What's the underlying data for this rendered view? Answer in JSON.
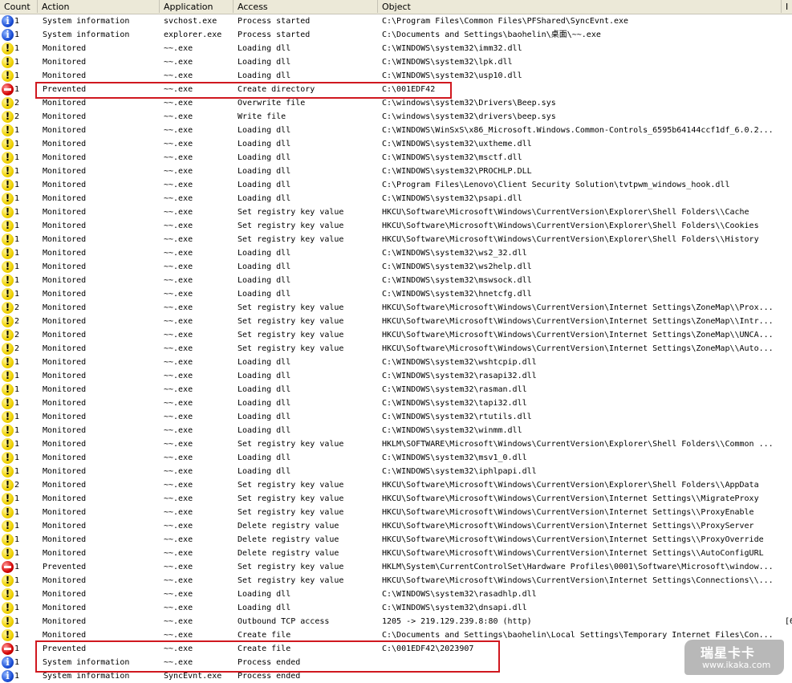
{
  "columns": [
    "Count",
    "Action",
    "Application",
    "Access",
    "Object",
    "I"
  ],
  "rows": [
    {
      "icon": "info",
      "count": "1",
      "action": "System information",
      "app": "svchost.exe",
      "access": "Process started",
      "object": "C:\\Program Files\\Common Files\\PFShared\\SyncEvnt.exe",
      "extra": ""
    },
    {
      "icon": "info",
      "count": "1",
      "action": "System information",
      "app": "explorer.exe",
      "access": "Process started",
      "object": "C:\\Documents and Settings\\baohelin\\桌面\\~~.exe",
      "extra": ""
    },
    {
      "icon": "warn",
      "count": "1",
      "action": "Monitored",
      "app": "~~.exe",
      "access": "Loading dll",
      "object": "C:\\WINDOWS\\system32\\imm32.dll",
      "extra": ""
    },
    {
      "icon": "warn",
      "count": "1",
      "action": "Monitored",
      "app": "~~.exe",
      "access": "Loading dll",
      "object": "C:\\WINDOWS\\system32\\lpk.dll",
      "extra": ""
    },
    {
      "icon": "warn",
      "count": "1",
      "action": "Monitored",
      "app": "~~.exe",
      "access": "Loading dll",
      "object": "C:\\WINDOWS\\system32\\usp10.dll",
      "extra": ""
    },
    {
      "icon": "stop",
      "count": "1",
      "action": "Prevented",
      "app": "~~.exe",
      "access": "Create directory",
      "object": "C:\\001EDF42",
      "extra": ""
    },
    {
      "icon": "warn",
      "count": "2",
      "action": "Monitored",
      "app": "~~.exe",
      "access": "Overwrite file",
      "object": "C:\\windows\\system32\\Drivers\\Beep.sys",
      "extra": ""
    },
    {
      "icon": "warn",
      "count": "2",
      "action": "Monitored",
      "app": "~~.exe",
      "access": "Write file",
      "object": "C:\\windows\\system32\\drivers\\beep.sys",
      "extra": ""
    },
    {
      "icon": "warn",
      "count": "1",
      "action": "Monitored",
      "app": "~~.exe",
      "access": "Loading dll",
      "object": "C:\\WINDOWS\\WinSxS\\x86_Microsoft.Windows.Common-Controls_6595b64144ccf1df_6.0.2...",
      "extra": ""
    },
    {
      "icon": "warn",
      "count": "1",
      "action": "Monitored",
      "app": "~~.exe",
      "access": "Loading dll",
      "object": "C:\\WINDOWS\\system32\\uxtheme.dll",
      "extra": ""
    },
    {
      "icon": "warn",
      "count": "1",
      "action": "Monitored",
      "app": "~~.exe",
      "access": "Loading dll",
      "object": "C:\\WINDOWS\\system32\\msctf.dll",
      "extra": ""
    },
    {
      "icon": "warn",
      "count": "1",
      "action": "Monitored",
      "app": "~~.exe",
      "access": "Loading dll",
      "object": "C:\\WINDOWS\\system32\\PROCHLP.DLL",
      "extra": ""
    },
    {
      "icon": "warn",
      "count": "1",
      "action": "Monitored",
      "app": "~~.exe",
      "access": "Loading dll",
      "object": "C:\\Program Files\\Lenovo\\Client Security Solution\\tvtpwm_windows_hook.dll",
      "extra": ""
    },
    {
      "icon": "warn",
      "count": "1",
      "action": "Monitored",
      "app": "~~.exe",
      "access": "Loading dll",
      "object": "C:\\WINDOWS\\system32\\psapi.dll",
      "extra": ""
    },
    {
      "icon": "warn",
      "count": "1",
      "action": "Monitored",
      "app": "~~.exe",
      "access": "Set registry key value",
      "object": "HKCU\\Software\\Microsoft\\Windows\\CurrentVersion\\Explorer\\Shell Folders\\\\Cache",
      "extra": ""
    },
    {
      "icon": "warn",
      "count": "1",
      "action": "Monitored",
      "app": "~~.exe",
      "access": "Set registry key value",
      "object": "HKCU\\Software\\Microsoft\\Windows\\CurrentVersion\\Explorer\\Shell Folders\\\\Cookies",
      "extra": ""
    },
    {
      "icon": "warn",
      "count": "1",
      "action": "Monitored",
      "app": "~~.exe",
      "access": "Set registry key value",
      "object": "HKCU\\Software\\Microsoft\\Windows\\CurrentVersion\\Explorer\\Shell Folders\\\\History",
      "extra": ""
    },
    {
      "icon": "warn",
      "count": "1",
      "action": "Monitored",
      "app": "~~.exe",
      "access": "Loading dll",
      "object": "C:\\WINDOWS\\system32\\ws2_32.dll",
      "extra": ""
    },
    {
      "icon": "warn",
      "count": "1",
      "action": "Monitored",
      "app": "~~.exe",
      "access": "Loading dll",
      "object": "C:\\WINDOWS\\system32\\ws2help.dll",
      "extra": ""
    },
    {
      "icon": "warn",
      "count": "1",
      "action": "Monitored",
      "app": "~~.exe",
      "access": "Loading dll",
      "object": "C:\\WINDOWS\\system32\\mswsock.dll",
      "extra": ""
    },
    {
      "icon": "warn",
      "count": "1",
      "action": "Monitored",
      "app": "~~.exe",
      "access": "Loading dll",
      "object": "C:\\WINDOWS\\system32\\hnetcfg.dll",
      "extra": ""
    },
    {
      "icon": "warn",
      "count": "2",
      "action": "Monitored",
      "app": "~~.exe",
      "access": "Set registry key value",
      "object": "HKCU\\Software\\Microsoft\\Windows\\CurrentVersion\\Internet Settings\\ZoneMap\\\\Prox...",
      "extra": ""
    },
    {
      "icon": "warn",
      "count": "2",
      "action": "Monitored",
      "app": "~~.exe",
      "access": "Set registry key value",
      "object": "HKCU\\Software\\Microsoft\\Windows\\CurrentVersion\\Internet Settings\\ZoneMap\\\\Intr...",
      "extra": ""
    },
    {
      "icon": "warn",
      "count": "2",
      "action": "Monitored",
      "app": "~~.exe",
      "access": "Set registry key value",
      "object": "HKCU\\Software\\Microsoft\\Windows\\CurrentVersion\\Internet Settings\\ZoneMap\\\\UNCA...",
      "extra": ""
    },
    {
      "icon": "warn",
      "count": "2",
      "action": "Monitored",
      "app": "~~.exe",
      "access": "Set registry key value",
      "object": "HKCU\\Software\\Microsoft\\Windows\\CurrentVersion\\Internet Settings\\ZoneMap\\\\Auto...",
      "extra": ""
    },
    {
      "icon": "warn",
      "count": "1",
      "action": "Monitored",
      "app": "~~.exe",
      "access": "Loading dll",
      "object": "C:\\WINDOWS\\system32\\wshtcpip.dll",
      "extra": ""
    },
    {
      "icon": "warn",
      "count": "1",
      "action": "Monitored",
      "app": "~~.exe",
      "access": "Loading dll",
      "object": "C:\\WINDOWS\\system32\\rasapi32.dll",
      "extra": ""
    },
    {
      "icon": "warn",
      "count": "1",
      "action": "Monitored",
      "app": "~~.exe",
      "access": "Loading dll",
      "object": "C:\\WINDOWS\\system32\\rasman.dll",
      "extra": ""
    },
    {
      "icon": "warn",
      "count": "1",
      "action": "Monitored",
      "app": "~~.exe",
      "access": "Loading dll",
      "object": "C:\\WINDOWS\\system32\\tapi32.dll",
      "extra": ""
    },
    {
      "icon": "warn",
      "count": "1",
      "action": "Monitored",
      "app": "~~.exe",
      "access": "Loading dll",
      "object": "C:\\WINDOWS\\system32\\rtutils.dll",
      "extra": ""
    },
    {
      "icon": "warn",
      "count": "1",
      "action": "Monitored",
      "app": "~~.exe",
      "access": "Loading dll",
      "object": "C:\\WINDOWS\\system32\\winmm.dll",
      "extra": ""
    },
    {
      "icon": "warn",
      "count": "1",
      "action": "Monitored",
      "app": "~~.exe",
      "access": "Set registry key value",
      "object": "HKLM\\SOFTWARE\\Microsoft\\Windows\\CurrentVersion\\Explorer\\Shell Folders\\\\Common ...",
      "extra": ""
    },
    {
      "icon": "warn",
      "count": "1",
      "action": "Monitored",
      "app": "~~.exe",
      "access": "Loading dll",
      "object": "C:\\WINDOWS\\system32\\msv1_0.dll",
      "extra": ""
    },
    {
      "icon": "warn",
      "count": "1",
      "action": "Monitored",
      "app": "~~.exe",
      "access": "Loading dll",
      "object": "C:\\WINDOWS\\system32\\iphlpapi.dll",
      "extra": ""
    },
    {
      "icon": "warn",
      "count": "2",
      "action": "Monitored",
      "app": "~~.exe",
      "access": "Set registry key value",
      "object": "HKCU\\Software\\Microsoft\\Windows\\CurrentVersion\\Explorer\\Shell Folders\\\\AppData",
      "extra": ""
    },
    {
      "icon": "warn",
      "count": "1",
      "action": "Monitored",
      "app": "~~.exe",
      "access": "Set registry key value",
      "object": "HKCU\\Software\\Microsoft\\Windows\\CurrentVersion\\Internet Settings\\\\MigrateProxy",
      "extra": ""
    },
    {
      "icon": "warn",
      "count": "1",
      "action": "Monitored",
      "app": "~~.exe",
      "access": "Set registry key value",
      "object": "HKCU\\Software\\Microsoft\\Windows\\CurrentVersion\\Internet Settings\\\\ProxyEnable",
      "extra": ""
    },
    {
      "icon": "warn",
      "count": "1",
      "action": "Monitored",
      "app": "~~.exe",
      "access": "Delete registry value",
      "object": "HKCU\\Software\\Microsoft\\Windows\\CurrentVersion\\Internet Settings\\\\ProxyServer",
      "extra": ""
    },
    {
      "icon": "warn",
      "count": "1",
      "action": "Monitored",
      "app": "~~.exe",
      "access": "Delete registry value",
      "object": "HKCU\\Software\\Microsoft\\Windows\\CurrentVersion\\Internet Settings\\\\ProxyOverride",
      "extra": ""
    },
    {
      "icon": "warn",
      "count": "1",
      "action": "Monitored",
      "app": "~~.exe",
      "access": "Delete registry value",
      "object": "HKCU\\Software\\Microsoft\\Windows\\CurrentVersion\\Internet Settings\\\\AutoConfigURL",
      "extra": ""
    },
    {
      "icon": "stop",
      "count": "1",
      "action": "Prevented",
      "app": "~~.exe",
      "access": "Set registry key value",
      "object": "HKLM\\System\\CurrentControlSet\\Hardware Profiles\\0001\\Software\\Microsoft\\window...",
      "extra": ""
    },
    {
      "icon": "warn",
      "count": "1",
      "action": "Monitored",
      "app": "~~.exe",
      "access": "Set registry key value",
      "object": "HKCU\\Software\\Microsoft\\Windows\\CurrentVersion\\Internet Settings\\Connections\\\\...",
      "extra": ""
    },
    {
      "icon": "warn",
      "count": "1",
      "action": "Monitored",
      "app": "~~.exe",
      "access": "Loading dll",
      "object": "C:\\WINDOWS\\system32\\rasadhlp.dll",
      "extra": ""
    },
    {
      "icon": "warn",
      "count": "1",
      "action": "Monitored",
      "app": "~~.exe",
      "access": "Loading dll",
      "object": "C:\\WINDOWS\\system32\\dnsapi.dll",
      "extra": ""
    },
    {
      "icon": "warn",
      "count": "1",
      "action": "Monitored",
      "app": "~~.exe",
      "access": "Outbound TCP access",
      "object": "1205 -> 219.129.239.8:80 (http)",
      "extra": "[6"
    },
    {
      "icon": "warn",
      "count": "1",
      "action": "Monitored",
      "app": "~~.exe",
      "access": "Create file",
      "object": "C:\\Documents and Settings\\baohelin\\Local Settings\\Temporary Internet Files\\Con...",
      "extra": ""
    },
    {
      "icon": "stop",
      "count": "1",
      "action": "Prevented",
      "app": "~~.exe",
      "access": "Create file",
      "object": "C:\\001EDF42\\2023907",
      "extra": ""
    },
    {
      "icon": "info",
      "count": "1",
      "action": "System information",
      "app": "~~.exe",
      "access": "Process ended",
      "object": "",
      "extra": ""
    },
    {
      "icon": "info",
      "count": "1",
      "action": "System information",
      "app": "SyncEvnt.exe",
      "access": "Process ended",
      "object": "",
      "extra": ""
    }
  ],
  "watermark": {
    "brand": "瑞星卡卡",
    "url": "www.ikaka.com"
  },
  "colors": {
    "highlight": "#d0181f",
    "header_bg": "#ece9d8"
  }
}
